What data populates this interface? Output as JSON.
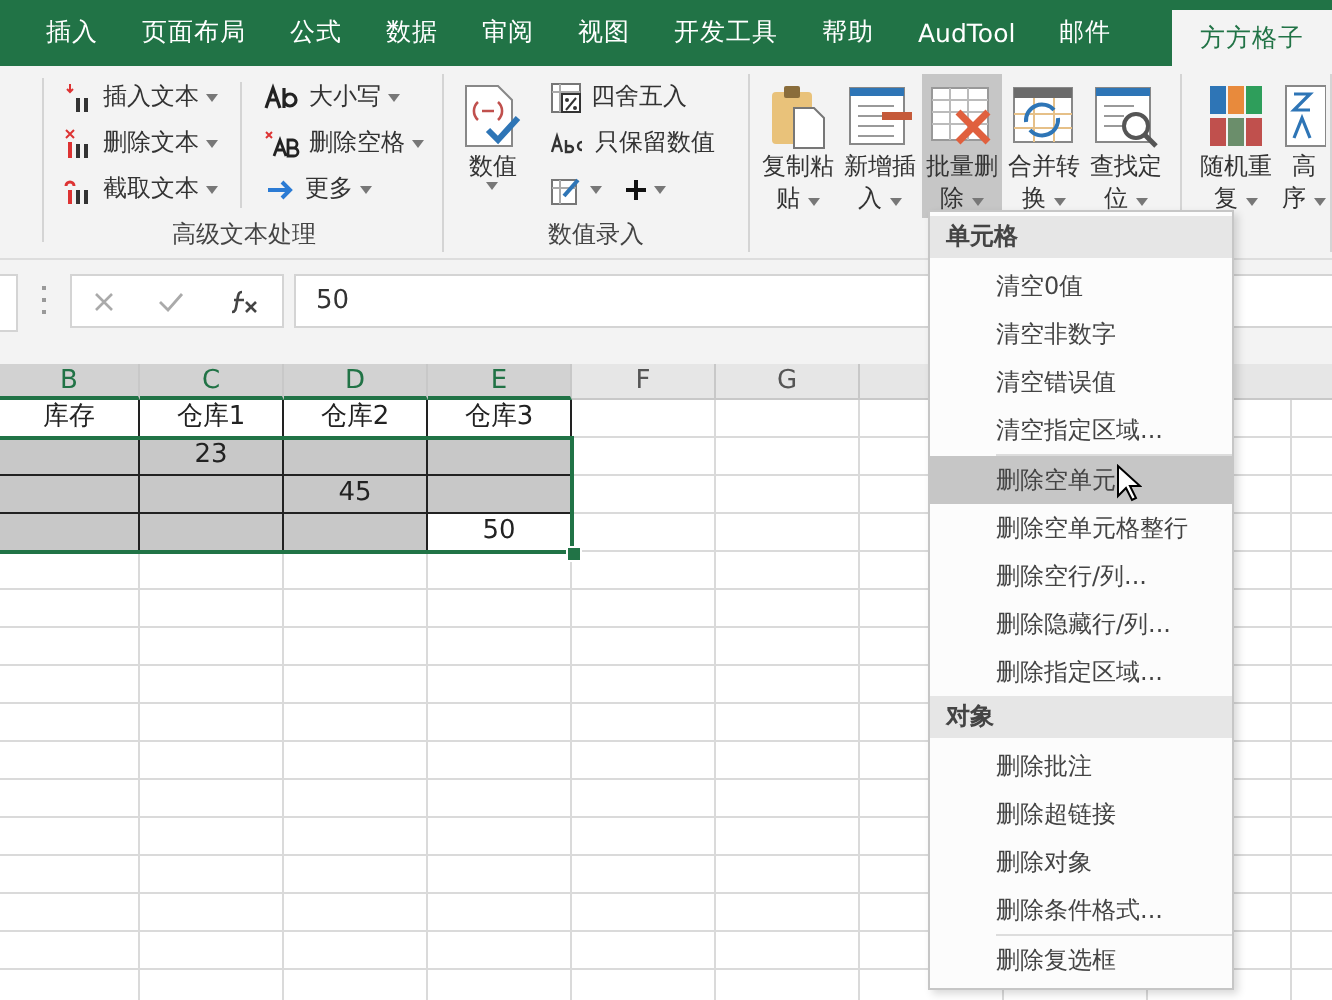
{
  "tabs": [
    {
      "label": "插入",
      "selected": false
    },
    {
      "label": "页面布局",
      "selected": false
    },
    {
      "label": "公式",
      "selected": false
    },
    {
      "label": "数据",
      "selected": false
    },
    {
      "label": "审阅",
      "selected": false
    },
    {
      "label": "视图",
      "selected": false
    },
    {
      "label": "开发工具",
      "selected": false
    },
    {
      "label": "帮助",
      "selected": false
    },
    {
      "label": "AudTool",
      "selected": false
    },
    {
      "label": "邮件",
      "selected": false
    },
    {
      "label": "方方格子",
      "selected": true
    }
  ],
  "text_group": {
    "label": "高级文本处理",
    "columns": [
      [
        {
          "label": "插入文本"
        },
        {
          "label": "删除文本"
        },
        {
          "label": "截取文本"
        }
      ],
      [
        {
          "label": "大小写"
        },
        {
          "label": "删除空格"
        },
        {
          "label": "更多"
        }
      ]
    ]
  },
  "value_group": {
    "label": "数值录入",
    "big_button": "数值",
    "items": [
      {
        "label": "四舍五入"
      },
      {
        "label": "只保留数值"
      }
    ]
  },
  "batch_buttons": [
    {
      "lines": [
        "复制粘",
        "贴"
      ],
      "pressed": false
    },
    {
      "lines": [
        "新增插",
        "入"
      ],
      "pressed": false
    },
    {
      "lines": [
        "批量删",
        "除"
      ],
      "pressed": true
    },
    {
      "lines": [
        "合并转",
        "换"
      ],
      "pressed": false
    },
    {
      "lines": [
        "查找定",
        "位"
      ],
      "pressed": false
    },
    {
      "lines": [
        "随机重",
        "复"
      ],
      "pressed": false
    },
    {
      "lines": [
        "高",
        "序"
      ],
      "pressed": false
    }
  ],
  "formula_bar": {
    "value": "50"
  },
  "columns": [
    {
      "label": "B",
      "selected": true
    },
    {
      "label": "C",
      "selected": true
    },
    {
      "label": "D",
      "selected": true
    },
    {
      "label": "E",
      "selected": true
    },
    {
      "label": "F",
      "selected": false
    },
    {
      "label": "G",
      "selected": false
    }
  ],
  "rows": [
    [
      {
        "text": "库存",
        "filled": false
      },
      {
        "text": "仓库1",
        "filled": false
      },
      {
        "text": "仓库2",
        "filled": false
      },
      {
        "text": "仓库3",
        "filled": false
      }
    ],
    [
      {
        "text": "",
        "filled": true
      },
      {
        "text": "23",
        "filled": true
      },
      {
        "text": "",
        "filled": true
      },
      {
        "text": "",
        "filled": true
      }
    ],
    [
      {
        "text": "",
        "filled": true
      },
      {
        "text": "",
        "filled": true
      },
      {
        "text": "45",
        "filled": true
      },
      {
        "text": "",
        "filled": true
      }
    ],
    [
      {
        "text": "",
        "filled": true
      },
      {
        "text": "",
        "filled": true
      },
      {
        "text": "",
        "filled": true
      },
      {
        "text": "50",
        "filled": false
      }
    ]
  ],
  "menu": [
    {
      "kind": "header",
      "label": "单元格"
    },
    {
      "kind": "item",
      "label": "清空0值",
      "selected": false
    },
    {
      "kind": "item",
      "label": "清空非数字",
      "selected": false
    },
    {
      "kind": "item",
      "label": "清空错误值",
      "selected": false
    },
    {
      "kind": "item",
      "label": "清空指定区域...",
      "selected": false
    },
    {
      "kind": "separator"
    },
    {
      "kind": "item",
      "label": "删除空单元",
      "selected": true
    },
    {
      "kind": "item",
      "label": "删除空单元格整行",
      "selected": false
    },
    {
      "kind": "item",
      "label": "删除空行/列...",
      "selected": false
    },
    {
      "kind": "item",
      "label": "删除隐藏行/列...",
      "selected": false
    },
    {
      "kind": "item",
      "label": "删除指定区域...",
      "selected": false
    },
    {
      "kind": "header",
      "label": "对象"
    },
    {
      "kind": "item",
      "label": "删除批注",
      "selected": false
    },
    {
      "kind": "item",
      "label": "删除超链接",
      "selected": false
    },
    {
      "kind": "item",
      "label": "删除对象",
      "selected": false
    },
    {
      "kind": "item",
      "label": "删除条件格式...",
      "selected": false
    },
    {
      "kind": "separator"
    },
    {
      "kind": "item",
      "label": "删除复选框",
      "selected": false
    }
  ]
}
